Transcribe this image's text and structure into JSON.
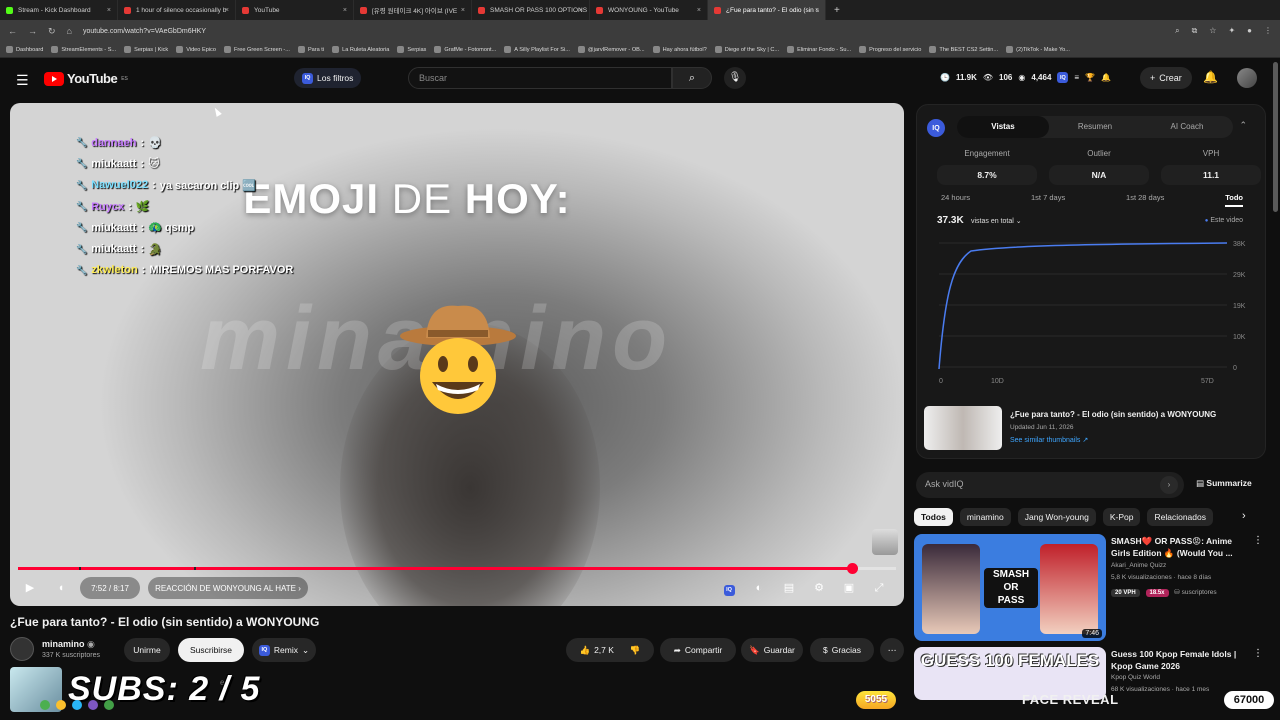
{
  "browser": {
    "tabs": [
      {
        "label": "Stream - Kick Dashboard",
        "kind": "kick"
      },
      {
        "label": "1 hour of silence occasionally b",
        "kind": "yt"
      },
      {
        "label": "YouTube",
        "kind": "yt"
      },
      {
        "label": "[유령 원테이크 4K] 아이브 (IVE",
        "kind": "yt"
      },
      {
        "label": "SMASH OR PASS 100 OPTIONS",
        "kind": "yt"
      },
      {
        "label": "WONYOUNG - YouTube",
        "kind": "yt"
      },
      {
        "label": "¿Fue para tanto? - El odio (sin s",
        "kind": "yt",
        "active": true
      }
    ],
    "url": "youtube.com/watch?v=VAeGbDm6HKY",
    "bookmarks": [
      "Dashboard",
      "StreamElements - S...",
      "Serpias | Kick",
      "Video Epico",
      "Free Green Screen -...",
      "Para ti",
      "La Ruleta Aleatoria",
      "Serpias",
      "GrafMe - Fotomont...",
      "A Silly Playlist For Si...",
      "@jarvIRemover - OB...",
      "Hay ahora fútbol?",
      "Diege of the Sky | C...",
      "Eliminar Fondo - Su...",
      "Progreso del servicio",
      "The BEST CS2 Settin...",
      "(2)TikTok - Make Yo..."
    ]
  },
  "header": {
    "logo": "YouTube",
    "region": "ES",
    "filters_label": "Los filtros",
    "search_placeholder": "Buscar",
    "stat_views": "11.9K",
    "stat_likes": "106",
    "stat_viewers": "4,464",
    "create_label": "Crear"
  },
  "player": {
    "headline_bold1": "EMOJI",
    "headline_thin": " DE ",
    "headline_bold2": "HOY:",
    "watermark": "minamino",
    "time": "7:52 / 8:17",
    "chapter": "REACCIÓN DE WONYOUNG AL HATE",
    "progress_fraction": 0.95,
    "buffer_markers": [
      0.07,
      0.2
    ]
  },
  "video": {
    "title": "¿Fue para tanto? - El odio (sin sentido) a WONYOUNG",
    "channel": "minamino",
    "subscribers": "337 K suscriptores",
    "join_label": "Unirme",
    "subscribe_label": "Suscribirse",
    "remix_label": "Remix",
    "likes": "2,7 K",
    "share_label": "Compartir",
    "save_label": "Guardar",
    "thanks_label": "Gracias",
    "desc_partial": "ero"
  },
  "overlay": {
    "subs_goal": "SUBS: 2 / 5",
    "coins": "5055",
    "face_reveal": "FACE REVEAL",
    "goal_total": "67000"
  },
  "vidiq": {
    "tabs": [
      "Vistas",
      "Resumen",
      "AI Coach"
    ],
    "active_tab": "Vistas",
    "metrics": [
      {
        "label": "Engagement",
        "value": "8.7%"
      },
      {
        "label": "Outlier",
        "value": "N/A"
      },
      {
        "label": "VPH",
        "value": "11.1"
      }
    ],
    "ranges": [
      "24 hours",
      "1st 7 days",
      "1st 28 days",
      "Todo"
    ],
    "active_range": "Todo",
    "total_views": "37.3K",
    "views_selector": "vistas en total",
    "legend_this": "Este video",
    "chart_y_ticks": [
      "38K",
      "29K",
      "19K",
      "10K",
      "0"
    ],
    "chart_x_ticks": [
      "0",
      "10D",
      "57D"
    ],
    "related_title": "¿Fue para tanto? - El odio (sin sentido) a WONYOUNG",
    "related_updated": "Updated Jun 11, 2026",
    "related_link": "See similar thumbnails ↗",
    "ask_placeholder": "Ask vidIQ",
    "summarize_label": "Summarize"
  },
  "chat": [
    {
      "user": "dannaeh",
      "msg": "💀",
      "color": "#c77dff"
    },
    {
      "user": "miukaatt",
      "msg": "🐱",
      "color": "#ffffff"
    },
    {
      "user": "Nawuel022",
      "msg": "ya sacaron clip 🆒",
      "color": "#7ee0ff"
    },
    {
      "user": "Ruycx",
      "msg": "🌿",
      "color": "#c77dff"
    },
    {
      "user": "miukaatt",
      "msg": "🦚 qsmp",
      "color": "#ffffff"
    },
    {
      "user": "miukaatt",
      "msg": "🐊",
      "color": "#ffffff"
    },
    {
      "user": "zkwleton",
      "msg": "MIREMOS MAS PORFAVOR",
      "color": "#ffee58"
    }
  ],
  "chips": [
    "Todos",
    "minamino",
    "Jang Won-young",
    "K-Pop",
    "Relacionados"
  ],
  "recommendations": [
    {
      "title": "SMASH❤️ OR PASS😡: Anime Girls Edition 🔥 (Would You ...",
      "channel": "Akari_Anime Quizz",
      "meta": "5,8 K visualizaciones · hace 8 días",
      "vph": "20 VPH",
      "outlier": "18.5x",
      "extra": "suscriptores",
      "duration": "7:46"
    },
    {
      "title": "Guess 100 Kpop Female Idols | Kpop Game 2026",
      "channel": "Kpop Quiz World",
      "meta": "68 K visualizaciones · hace 1 mes"
    }
  ],
  "colors": {
    "yt_red": "#ff0000",
    "progress": "#ff0033",
    "vidiq_blue": "#3b5bdb",
    "link": "#3ea6ff"
  }
}
